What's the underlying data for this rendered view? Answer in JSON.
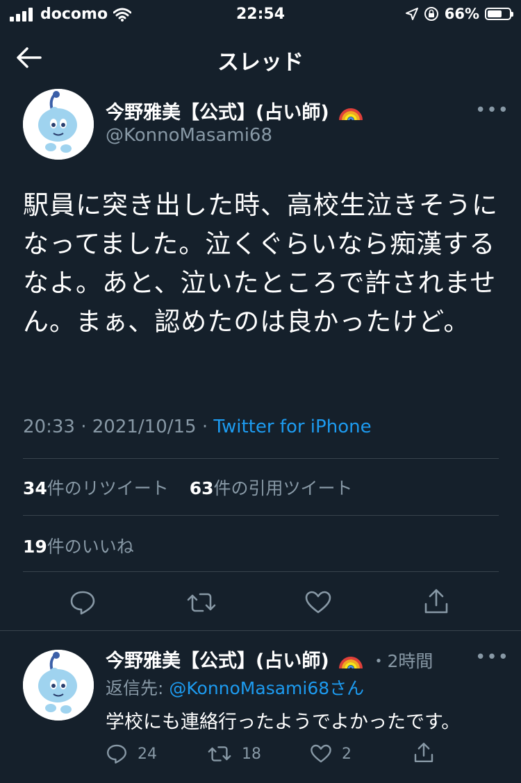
{
  "status_bar": {
    "carrier": "docomo",
    "time": "22:54",
    "battery": "66%"
  },
  "nav": {
    "title": "スレッド"
  },
  "tweet": {
    "display_name": "今野雅美【公式】(占い師)",
    "handle": "@KonnoMasami68",
    "emoji": "rainbow",
    "more": "•••",
    "text": "駅員に突き出した時、高校生泣きそうになってました。泣くぐらいなら痴漢するなよ。あと、泣いたところで許されません。まぁ、認めたのは良かったけど。",
    "time": "20:33",
    "date": "2021/10/15",
    "source": "Twitter for iPhone",
    "retweets_count": "34",
    "retweets_label": "件のリツイート",
    "quotes_count": "63",
    "quotes_label": "件の引用ツイート",
    "likes_count": "19",
    "likes_label": "件のいいね"
  },
  "reply": {
    "display_name": "今野雅美【公式】(占い師)",
    "age": "・2時間",
    "reply_prefix": "返信先: ",
    "reply_to": "@KonnoMasami68さん",
    "text": "学校にも連絡行ったようでよかったです。",
    "retweets": "18",
    "likes": "2",
    "replies": "24",
    "more": "•••"
  },
  "colors": {
    "background": "#15202b",
    "accent": "#1d9bf0",
    "muted": "#8899a6",
    "divider": "#38444d"
  }
}
